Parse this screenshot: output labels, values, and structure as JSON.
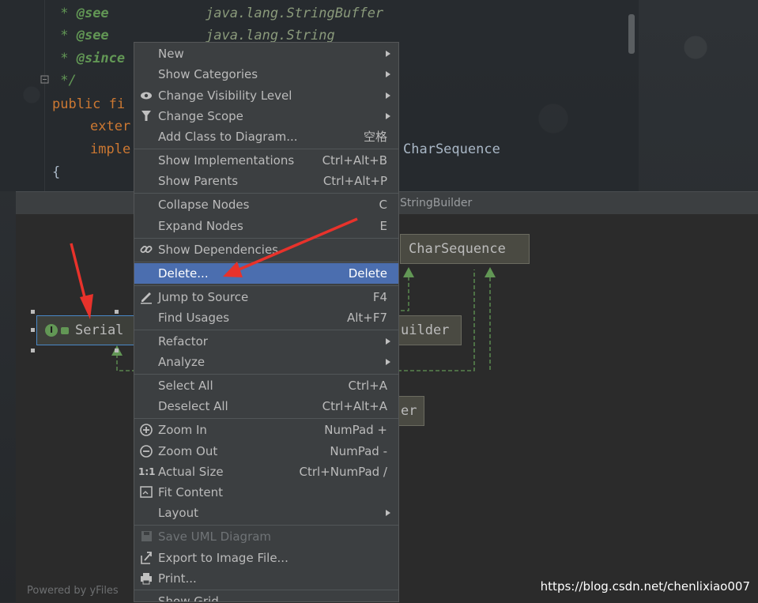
{
  "editor": {
    "lines": [
      {
        "a": " * ",
        "tag": "@see",
        "ref": "java.lang.StringBuffer"
      },
      {
        "a": " * ",
        "tag": "@see",
        "ref": "java.lang.String"
      },
      {
        "a": " * ",
        "tag": "@since",
        "ref": ""
      },
      {
        "a": " */",
        "tag": "",
        "ref": ""
      },
      {
        "kw": "public fi"
      },
      {
        "kw": "exter"
      },
      {
        "kw": "imple",
        "text": "CharSequence"
      },
      {
        "text": "{"
      }
    ]
  },
  "diagram": {
    "title": "StringBuilder",
    "nodes": {
      "serial": "Serial",
      "charsequence": "CharSequence",
      "builder": "uilder",
      "er": "er"
    },
    "badge_letter": "I",
    "powered_by": "Powered by yFiles"
  },
  "menu": {
    "items": [
      {
        "label": "New",
        "shortcut": "",
        "submenu": true,
        "icon": ""
      },
      {
        "label": "Show Categories",
        "shortcut": "",
        "submenu": true,
        "icon": ""
      },
      {
        "label": "Change Visibility Level",
        "shortcut": "",
        "submenu": true,
        "icon": "eye-icon"
      },
      {
        "label": "Change Scope",
        "shortcut": "",
        "submenu": true,
        "icon": "filter-icon"
      },
      {
        "label": "Add Class to Diagram...",
        "shortcut": "空格",
        "submenu": false,
        "icon": ""
      },
      {
        "label": "Show Implementations",
        "shortcut": "Ctrl+Alt+B",
        "submenu": false,
        "icon": ""
      },
      {
        "label": "Show Parents",
        "shortcut": "Ctrl+Alt+P",
        "submenu": false,
        "icon": ""
      },
      {
        "label": "Collapse Nodes",
        "shortcut": "C",
        "submenu": false,
        "icon": ""
      },
      {
        "label": "Expand Nodes",
        "shortcut": "E",
        "submenu": false,
        "icon": ""
      },
      {
        "label": "Show Dependencies",
        "shortcut": "",
        "submenu": false,
        "icon": "link-icon"
      },
      {
        "label": "Delete...",
        "shortcut": "Delete",
        "submenu": false,
        "icon": "",
        "highlighted": true
      },
      {
        "label": "Jump to Source",
        "shortcut": "F4",
        "submenu": false,
        "icon": "edit-icon"
      },
      {
        "label": "Find Usages",
        "shortcut": "Alt+F7",
        "submenu": false,
        "icon": ""
      },
      {
        "label": "Refactor",
        "shortcut": "",
        "submenu": true,
        "icon": ""
      },
      {
        "label": "Analyze",
        "shortcut": "",
        "submenu": true,
        "icon": ""
      },
      {
        "label": "Select All",
        "shortcut": "Ctrl+A",
        "submenu": false,
        "icon": ""
      },
      {
        "label": "Deselect All",
        "shortcut": "Ctrl+Alt+A",
        "submenu": false,
        "icon": ""
      },
      {
        "label": "Zoom In",
        "shortcut": "NumPad +",
        "submenu": false,
        "icon": "zoom-in-icon"
      },
      {
        "label": "Zoom Out",
        "shortcut": "NumPad -",
        "submenu": false,
        "icon": "zoom-out-icon"
      },
      {
        "label": "Actual Size",
        "shortcut": "Ctrl+NumPad /",
        "submenu": false,
        "icon": "actual-size-icon"
      },
      {
        "label": "Fit Content",
        "shortcut": "",
        "submenu": false,
        "icon": "fit-content-icon"
      },
      {
        "label": "Layout",
        "shortcut": "",
        "submenu": true,
        "icon": ""
      },
      {
        "label": "Save UML Diagram",
        "shortcut": "",
        "submenu": false,
        "icon": "save-icon",
        "disabled": true
      },
      {
        "label": "Export to Image File...",
        "shortcut": "",
        "submenu": false,
        "icon": "export-icon"
      },
      {
        "label": "Print...",
        "shortcut": "",
        "submenu": false,
        "icon": "print-icon"
      },
      {
        "label": "Show Grid",
        "shortcut": "",
        "submenu": false,
        "icon": ""
      }
    ]
  },
  "watermark": "https://blog.csdn.net/chenlixiao007",
  "colors": {
    "menu_bg": "#3c3f41",
    "highlight": "#4b6eaf",
    "annotation_arrow": "#e8322b",
    "comment_green": "#629755",
    "keyword_orange": "#cc7832"
  }
}
